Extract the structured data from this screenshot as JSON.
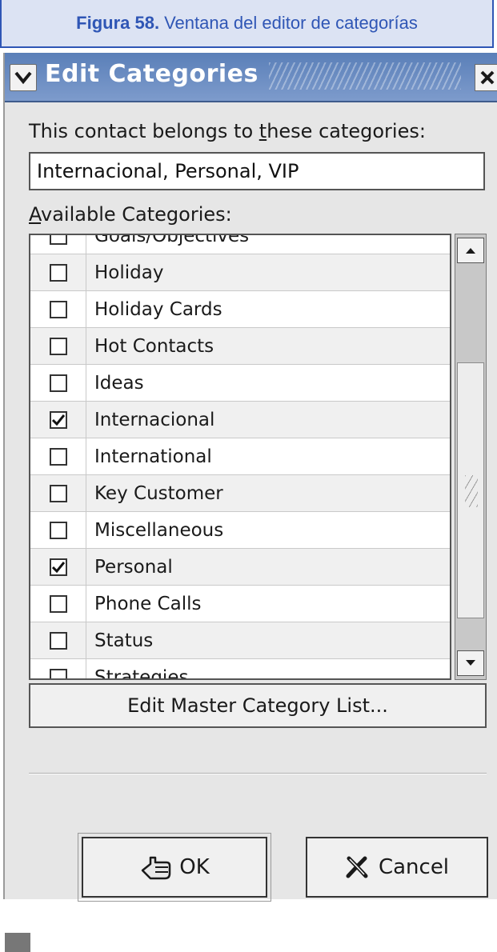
{
  "caption": {
    "figure": "Figura 58.",
    "text": "Ventana del editor de categorías"
  },
  "window": {
    "title": "Edit Categories"
  },
  "form": {
    "belongs_label_pre": "This contact belongs to ",
    "belongs_label_u": "t",
    "belongs_label_post": "hese categories:",
    "categories_value": "Internacional, Personal, VIP",
    "available_label_u": "A",
    "available_label_post": "vailable Categories:"
  },
  "categories": [
    {
      "label": "Goals/Objectives",
      "checked": false
    },
    {
      "label": "Holiday",
      "checked": false
    },
    {
      "label": "Holiday Cards",
      "checked": false
    },
    {
      "label": "Hot Contacts",
      "checked": false
    },
    {
      "label": "Ideas",
      "checked": false
    },
    {
      "label": "Internacional",
      "checked": true
    },
    {
      "label": "International",
      "checked": false
    },
    {
      "label": "Key Customer",
      "checked": false
    },
    {
      "label": "Miscellaneous",
      "checked": false
    },
    {
      "label": "Personal",
      "checked": true
    },
    {
      "label": "Phone Calls",
      "checked": false
    },
    {
      "label": "Status",
      "checked": false
    },
    {
      "label": "Strategies",
      "checked": false
    }
  ],
  "buttons": {
    "master": "Edit Master Category List...",
    "ok": "OK",
    "cancel": "Cancel"
  },
  "colors": {
    "caption_accent": "#2f56b5",
    "caption_bg": "#dce3f3",
    "titlebar": "#5a7fb8"
  }
}
